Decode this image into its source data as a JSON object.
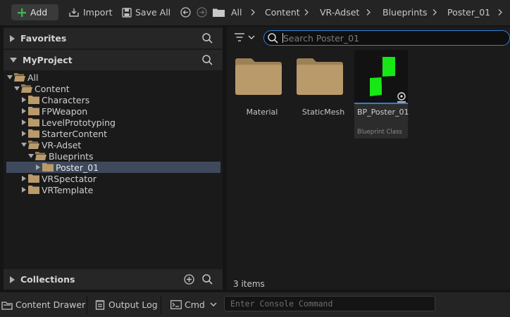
{
  "toolbar": {
    "add_label": "Add",
    "import_label": "Import",
    "save_all_label": "Save All",
    "breadcrumbs": [
      "All",
      "Content",
      "VR-Adset",
      "Blueprints",
      "Poster_01"
    ]
  },
  "left_panel": {
    "favorites_title": "Favorites",
    "project_title": "MyProject",
    "collections_title": "Collections",
    "tree": [
      {
        "label": "All",
        "level": 0,
        "expanded": true
      },
      {
        "label": "Content",
        "level": 1,
        "expanded": true
      },
      {
        "label": "Characters",
        "level": 2,
        "expanded": false
      },
      {
        "label": "FPWeapon",
        "level": 2,
        "expanded": false
      },
      {
        "label": "LevelPrototyping",
        "level": 2,
        "expanded": false
      },
      {
        "label": "StarterContent",
        "level": 2,
        "expanded": false
      },
      {
        "label": "VR-Adset",
        "level": 2,
        "expanded": true
      },
      {
        "label": "Blueprints",
        "level": 3,
        "expanded": true
      },
      {
        "label": "Poster_01",
        "level": 4,
        "expanded": false,
        "selected": true
      },
      {
        "label": "VRSpectator",
        "level": 2,
        "expanded": false
      },
      {
        "label": "VRTemplate",
        "level": 2,
        "expanded": false
      }
    ]
  },
  "content_browser": {
    "search_placeholder": "Search Poster_01",
    "assets": [
      {
        "name": "Material",
        "kind": "folder"
      },
      {
        "name": "StaticMesh",
        "kind": "folder"
      },
      {
        "name": "BP_Poster_01",
        "kind": "blueprint",
        "type_label": "Blueprint Class"
      }
    ],
    "item_count": "3 items"
  },
  "status_bar": {
    "content_drawer_label": "Content Drawer",
    "output_log_label": "Output Log",
    "cmd_label": "Cmd",
    "console_placeholder": "Enter Console Command"
  },
  "colors": {
    "accent": "#2f7fd8",
    "folder": "#b99a6b",
    "add_green": "#3fb24f",
    "selection": "#3e4a5c"
  },
  "icons": [
    "plus-icon",
    "import-icon",
    "save-icon",
    "back-icon",
    "forward-icon",
    "folder-icon",
    "search-icon",
    "filter-icon",
    "add-circle-icon",
    "content-drawer-icon",
    "output-log-icon",
    "cmd-icon"
  ]
}
